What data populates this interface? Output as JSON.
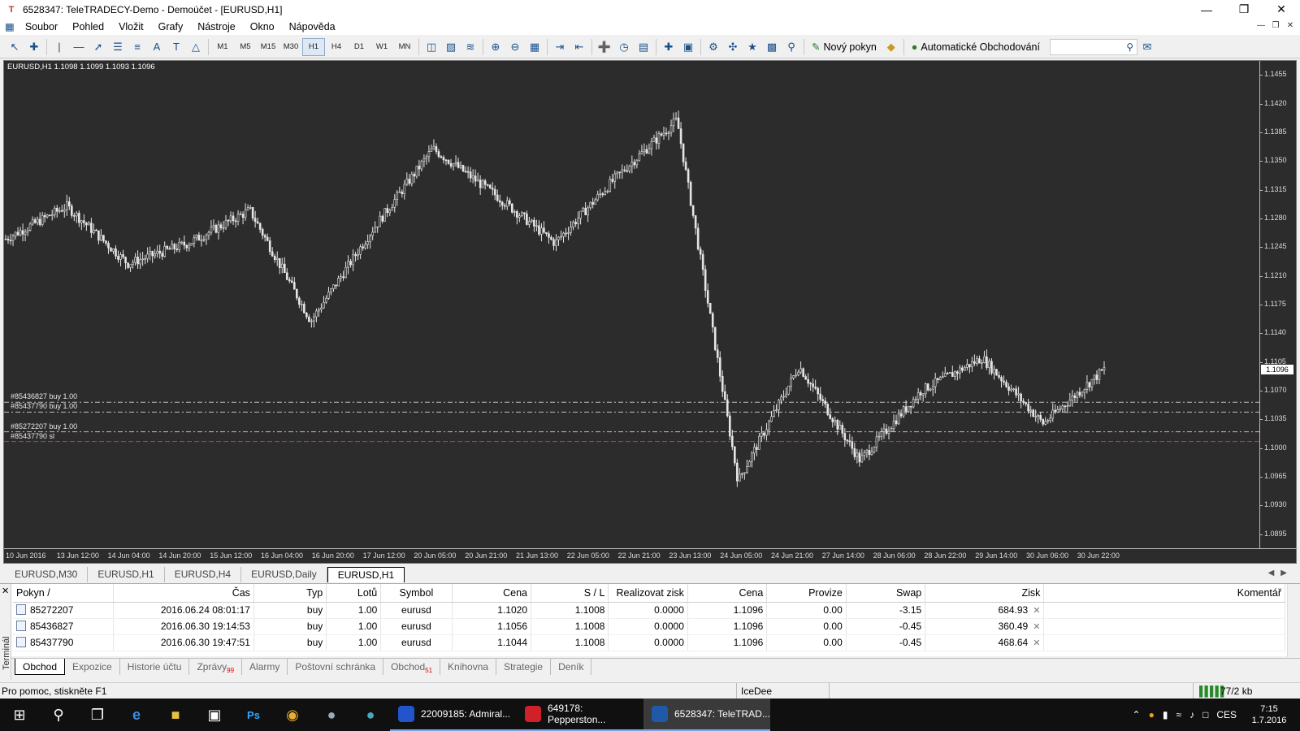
{
  "window": {
    "title": "6528347: TeleTRADECY-Demo - Demoúčet - [EURUSD,H1]",
    "app_icon_text": "T"
  },
  "menu": [
    "Soubor",
    "Pohled",
    "Vložit",
    "Grafy",
    "Nástroje",
    "Okno",
    "Nápověda"
  ],
  "toolbar": {
    "timeframes": [
      "M1",
      "M5",
      "M15",
      "M30",
      "H1",
      "H4",
      "D1",
      "W1",
      "MN"
    ],
    "active_timeframe": "H1",
    "new_order_label": "Nový pokyn",
    "auto_trading_label": "Automatické Obchodování"
  },
  "chart": {
    "header": "EURUSD,H1  1.1098 1.1099 1.1093 1.1096",
    "current_price": "1.1096",
    "price_ticks": [
      "1.1455",
      "1.1420",
      "1.1385",
      "1.1350",
      "1.1315",
      "1.1280",
      "1.1245",
      "1.1210",
      "1.1175",
      "1.1140",
      "1.1105",
      "1.1070",
      "1.1035",
      "1.1000",
      "1.0965",
      "1.0930",
      "1.0895"
    ],
    "time_ticks": [
      "10 Jun 2016",
      "13 Jun 12:00",
      "14 Jun 04:00",
      "14 Jun 20:00",
      "15 Jun 12:00",
      "16 Jun 04:00",
      "16 Jun 20:00",
      "17 Jun 12:00",
      "20 Jun 05:00",
      "20 Jun 21:00",
      "21 Jun 13:00",
      "22 Jun 05:00",
      "22 Jun 21:00",
      "23 Jun 13:00",
      "24 Jun 05:00",
      "24 Jun 21:00",
      "27 Jun 14:00",
      "28 Jun 06:00",
      "28 Jun 22:00",
      "29 Jun 14:00",
      "30 Jun 06:00",
      "30 Jun 22:00"
    ],
    "order_lines": [
      {
        "label": "#85436827 buy 1.00",
        "price": 1.1056,
        "color": "#bfbfbf"
      },
      {
        "label": "#85437790 buy 1.00",
        "price": 1.1044,
        "color": "#bfbfbf"
      },
      {
        "label": "#85272207 buy 1.00",
        "price": 1.102,
        "color": "#bfbfbf"
      },
      {
        "label": "#85437790 sl",
        "price": 1.1008,
        "color": "#e03030"
      }
    ],
    "colors": {
      "background": "#2c2c2c",
      "candle": "#e6e6e6",
      "sl_line": "#e03030"
    }
  },
  "chart_data": {
    "type": "line",
    "title": "EURUSD,H1",
    "xlabel": "",
    "ylabel": "",
    "ylim": [
      1.0878,
      1.1472
    ],
    "x": [
      "10 Jun 2016",
      "13 Jun",
      "14 Jun",
      "15 Jun",
      "16 Jun",
      "16 Jun PM",
      "17 Jun",
      "20 Jun",
      "21 Jun",
      "22 Jun",
      "23 Jun",
      "23 Jun PM",
      "24 Jun",
      "24 Jun PM",
      "27 Jun",
      "28 Jun",
      "29 Jun",
      "30 Jun",
      "30 Jun PM"
    ],
    "series": [
      {
        "name": "EURUSD",
        "values": [
          1.1255,
          1.1295,
          1.1225,
          1.125,
          1.129,
          1.1155,
          1.1265,
          1.1365,
          1.131,
          1.125,
          1.133,
          1.14,
          1.096,
          1.11,
          1.0985,
          1.107,
          1.111,
          1.103,
          1.1096
        ]
      }
    ]
  },
  "chart_tabs": [
    "EURUSD,M30",
    "EURUSD,H1",
    "EURUSD,H4",
    "EURUSD,Daily",
    "EURUSD,H1"
  ],
  "active_chart_tab": 4,
  "terminal": {
    "side_label": "Terminál",
    "columns": [
      "Pokyn",
      "Čas",
      "Typ",
      "Lotů",
      "Symbol",
      "Cena",
      "S / L",
      "Realizovat zisk",
      "Cena",
      "Provize",
      "Swap",
      "Zisk",
      "Komentář"
    ],
    "rows": [
      [
        "85272207",
        "2016.06.24 08:01:17",
        "buy",
        "1.00",
        "eurusd",
        "1.1020",
        "1.1008",
        "0.0000",
        "1.1096",
        "0.00",
        "-3.15",
        "684.93",
        ""
      ],
      [
        "85436827",
        "2016.06.30 19:14:53",
        "buy",
        "1.00",
        "eurusd",
        "1.1056",
        "1.1008",
        "0.0000",
        "1.1096",
        "0.00",
        "-0.45",
        "360.49",
        ""
      ],
      [
        "85437790",
        "2016.06.30 19:47:51",
        "buy",
        "1.00",
        "eurusd",
        "1.1044",
        "1.1008",
        "0.0000",
        "1.1096",
        "0.00",
        "-0.45",
        "468.64",
        ""
      ]
    ],
    "tabs": [
      {
        "label": "Obchod",
        "badge": ""
      },
      {
        "label": "Expozice",
        "badge": ""
      },
      {
        "label": "Historie účtu",
        "badge": ""
      },
      {
        "label": "Zprávy",
        "badge": "99"
      },
      {
        "label": "Alarmy",
        "badge": ""
      },
      {
        "label": "Poštovní schránka",
        "badge": ""
      },
      {
        "label": "Obchod",
        "badge": "51"
      },
      {
        "label": "Knihovna",
        "badge": ""
      },
      {
        "label": "Strategie",
        "badge": ""
      },
      {
        "label": "Deník",
        "badge": ""
      }
    ]
  },
  "status": {
    "help": "Pro pomoc, stiskněte F1",
    "profile": "IceDee",
    "traffic": "77/2 kb"
  },
  "taskbar": {
    "apps": [
      {
        "label": "22009185: Admiral...",
        "icon_color": "#2255cc"
      },
      {
        "label": "649178: Pepperston...",
        "icon_color": "#d0202a"
      },
      {
        "label": "6528347: TeleTRAD...",
        "icon_color": "#1e5aa8"
      }
    ],
    "language": "CES",
    "time": "7:15",
    "date": "1.7.2016"
  }
}
